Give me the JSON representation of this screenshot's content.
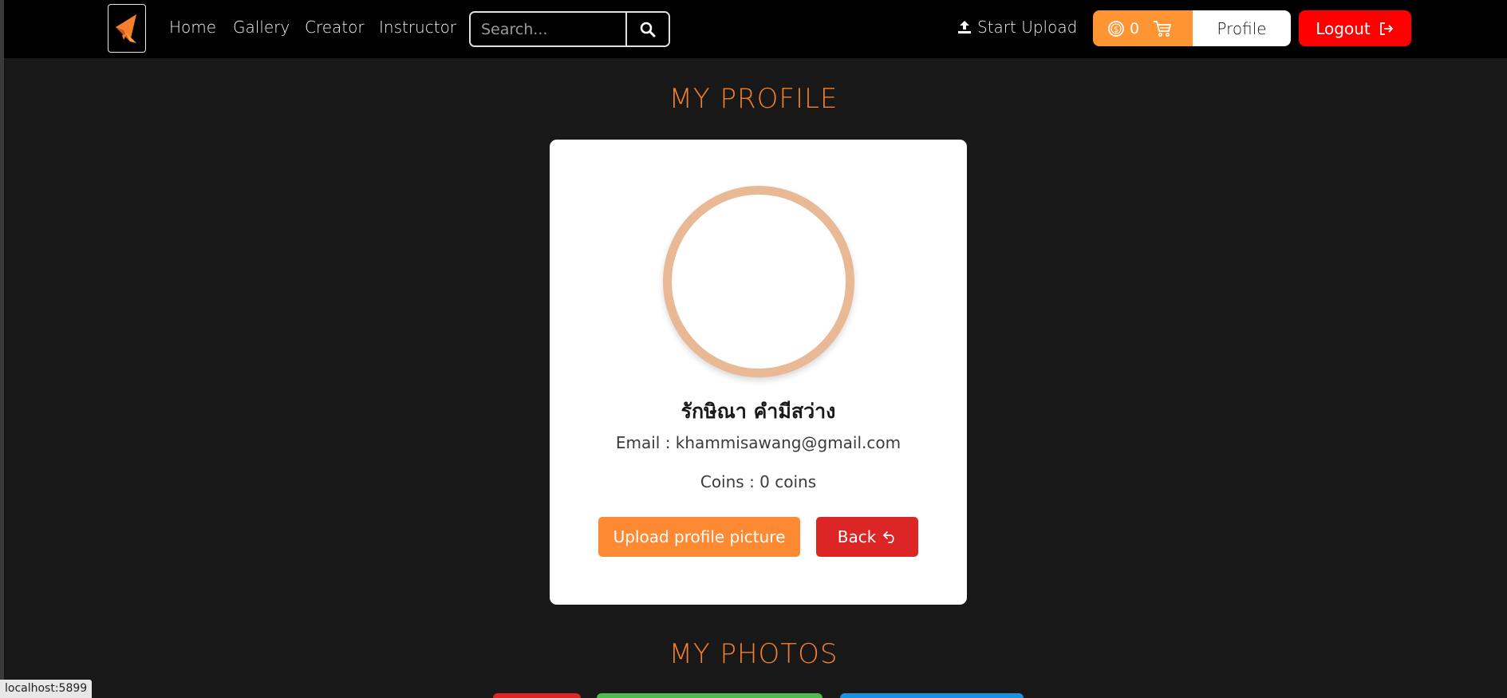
{
  "nav": {
    "links": [
      {
        "label": "Home"
      },
      {
        "label": "Gallery"
      },
      {
        "label": "Creator"
      },
      {
        "label": "Instructor"
      }
    ],
    "search_placeholder": "Search...",
    "upload_label": "Start Upload",
    "coins_count": "0",
    "profile_label": "Profile",
    "logout_label": "Logout"
  },
  "profile": {
    "heading": "MY PROFILE",
    "name": "รักษิณา คำมีสว่าง",
    "email": "Email : khammisawang@gmail.com",
    "coins": "Coins : 0 coins",
    "upload_button": "Upload profile picture",
    "back_button": "Back"
  },
  "photos": {
    "heading": "MY PHOTOS"
  },
  "status_bar": {
    "url": "localhost:5899"
  },
  "colors": {
    "accent": "#f57f2a",
    "logout": "#ff0000",
    "back": "#dc2626",
    "upload": "#fd8a33",
    "coin_pill": "#ff9433",
    "avatar_ring": "#e9b895"
  }
}
